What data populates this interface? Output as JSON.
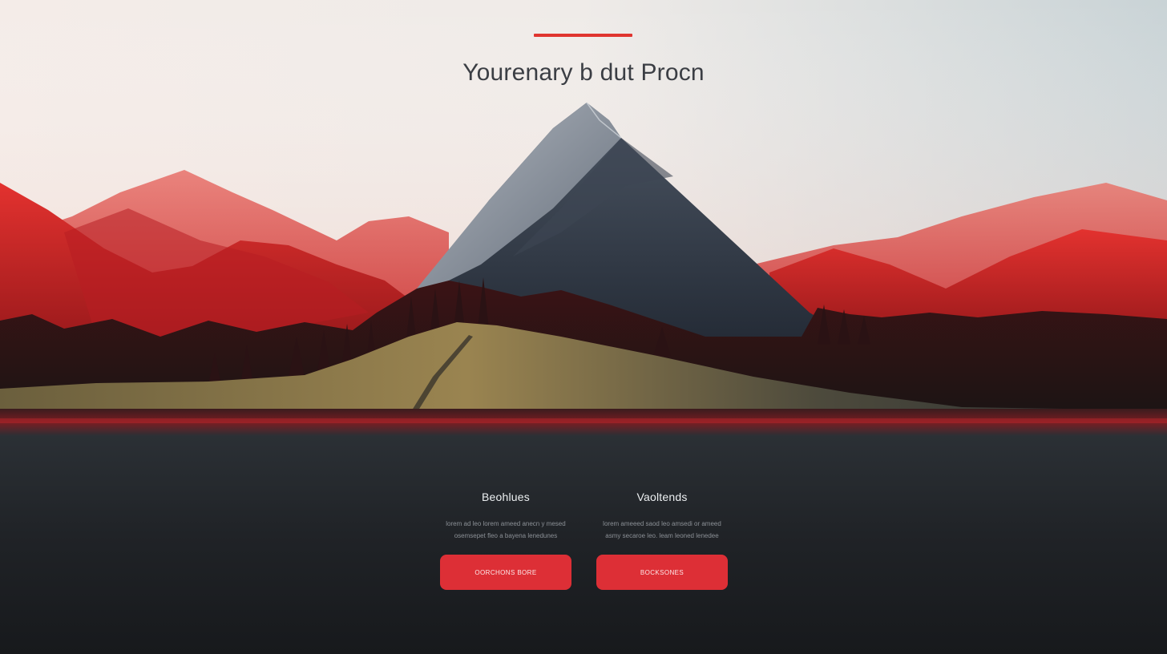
{
  "hero": {
    "title": "Yourenary b dut Procn",
    "image_alt": "Mountain landscape with red ranges, grey central peak, forest and lake",
    "accent_color": "#e0352f"
  },
  "cards": [
    {
      "title": "Beohlues",
      "text": "lorem ad leo lorem ameed anecn y mesed\nosemsepet fleo a bayena lenedunes",
      "button_label": "OORCHONS BORE"
    },
    {
      "title": "Vaoltends",
      "text": "lorem ameeed saod leo amsedi or ameed\nasmy secaroe leo. leam leoned lenedee",
      "button_label": "BOCKSONES"
    }
  ],
  "colors": {
    "button": "#dd2f36",
    "lower_background": "#202327",
    "title_text": "#3b3e44"
  }
}
